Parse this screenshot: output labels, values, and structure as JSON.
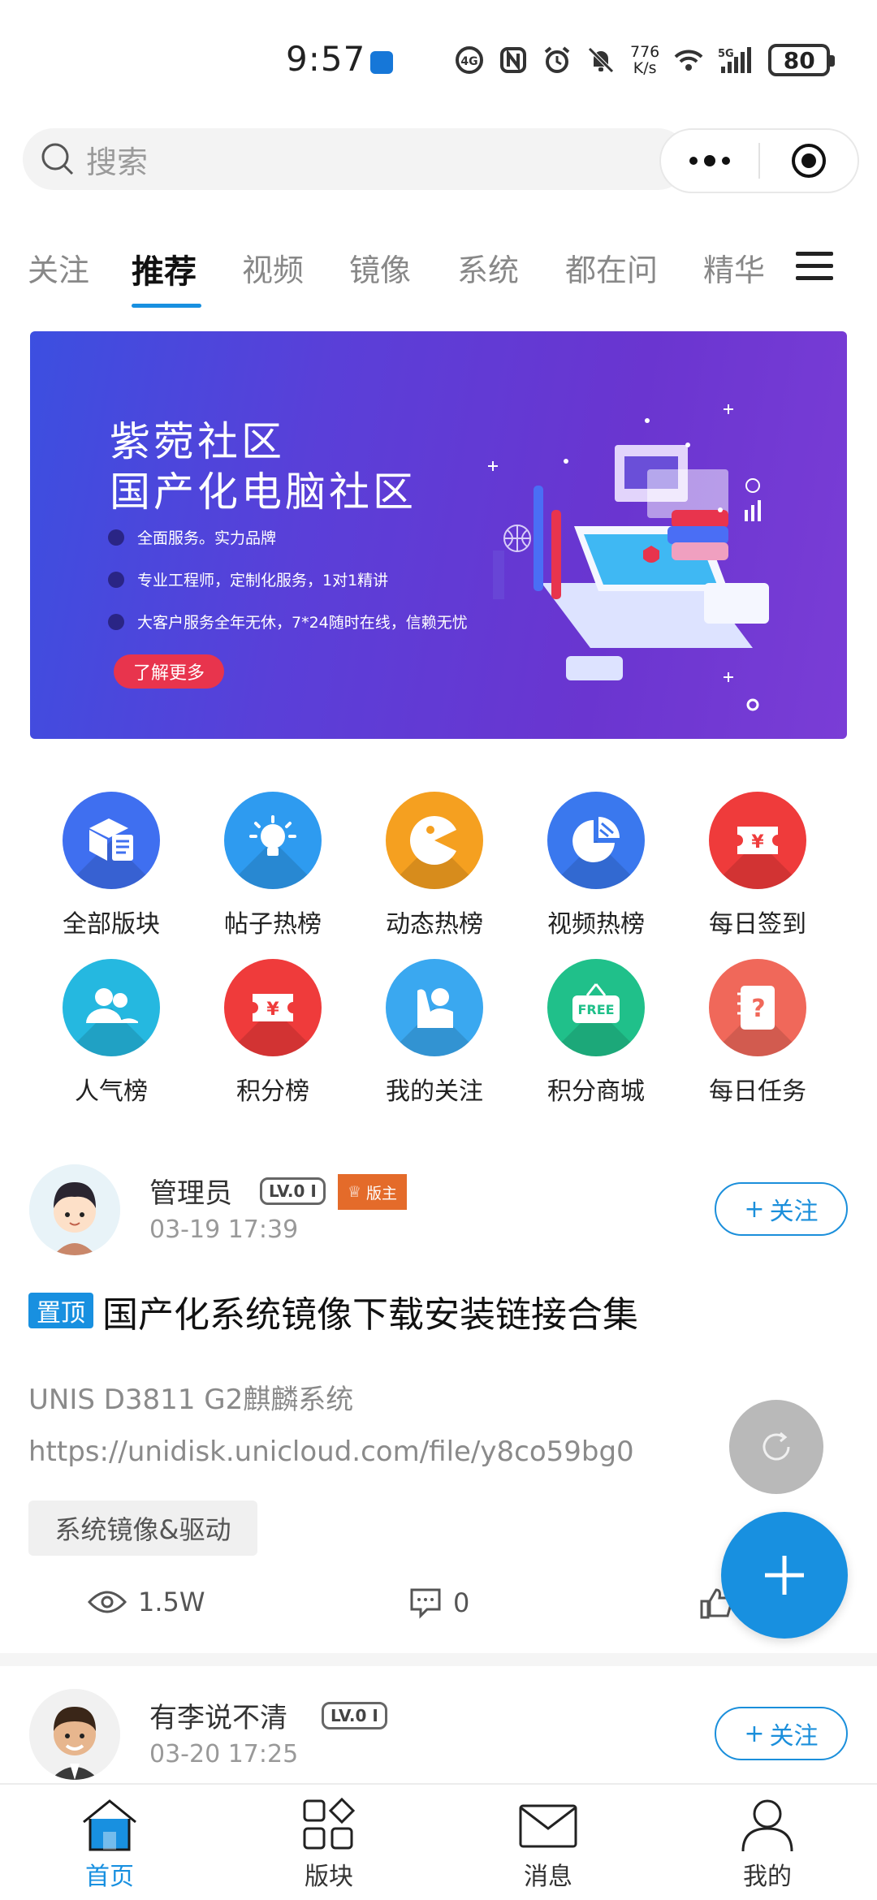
{
  "status_bar": {
    "time": "9:57",
    "net_speed_value": "776",
    "net_speed_unit": "K/s",
    "network": "5G",
    "battery": "80"
  },
  "search": {
    "placeholder": "搜索"
  },
  "tabs": [
    {
      "label": "关注"
    },
    {
      "label": "推荐"
    },
    {
      "label": "视频"
    },
    {
      "label": "镜像"
    },
    {
      "label": "系统"
    },
    {
      "label": "都在问"
    },
    {
      "label": "精华"
    }
  ],
  "banner": {
    "title_line1": "紫菀社区",
    "title_line2": "国产化电脑社区",
    "bullets": [
      "全面服务。实力品牌",
      "专业工程师，定制化服务，1对1精讲",
      "大客户服务全年无休，7*24随时在线，信赖无忧"
    ],
    "button": "了解更多"
  },
  "grid": [
    {
      "label": "全部版块",
      "icon": "cube-doc-icon",
      "color": "#3f6ff0"
    },
    {
      "label": "帖子热榜",
      "icon": "lightbulb-icon",
      "color": "#2e9bf0"
    },
    {
      "label": "动态热榜",
      "icon": "pacman-icon",
      "color": "#f5a020"
    },
    {
      "label": "视频热榜",
      "icon": "pie-chart-icon",
      "color": "#3a78ee"
    },
    {
      "label": "每日签到",
      "icon": "yen-ticket-icon",
      "color": "#ef3b3b"
    },
    {
      "label": "人气榜",
      "icon": "users-icon",
      "color": "#25b8e0"
    },
    {
      "label": "积分榜",
      "icon": "yen-ticket-icon",
      "color": "#ef3b3b"
    },
    {
      "label": "我的关注",
      "icon": "person-wave-icon",
      "color": "#3aa8f0"
    },
    {
      "label": "积分商城",
      "icon": "free-sign-icon",
      "color": "#20c08a"
    },
    {
      "label": "每日任务",
      "icon": "question-book-icon",
      "color": "#f0685a"
    }
  ],
  "posts": [
    {
      "username": "管理员",
      "level": "LV.0 I",
      "badge": "版主",
      "time": "03-19 17:39",
      "follow": "关注",
      "pin": "置顶",
      "title": "国产化系统镜像下载安装链接合集",
      "line1": "UNIS D3811 G2麒麟系统",
      "line2": "https://unidisk.unicloud.com/file/y8co59bg0",
      "tag": "系统镜像&驱动",
      "views": "1.5W",
      "comments": "0"
    },
    {
      "username": "有李说不清",
      "level": "LV.0 I",
      "time": "03-20 17:25",
      "follow": "关注"
    }
  ],
  "bottom_nav": [
    {
      "label": "首页",
      "active": true
    },
    {
      "label": "版块"
    },
    {
      "label": "消息"
    },
    {
      "label": "我的"
    }
  ],
  "colors": {
    "accent": "#1890e0",
    "mod_badge": "#e46b2a",
    "banner_btn": "#e8344d"
  }
}
